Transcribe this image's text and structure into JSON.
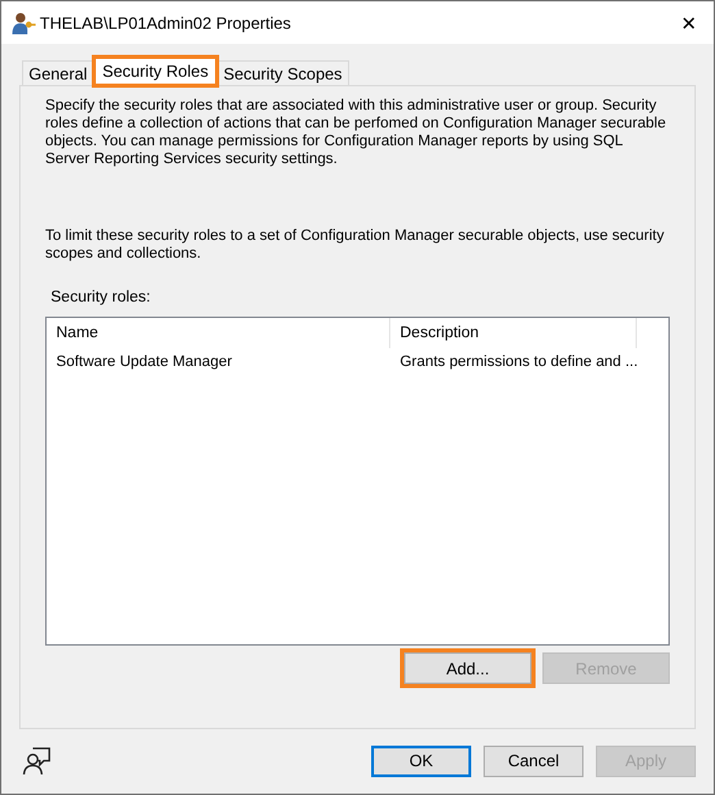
{
  "window": {
    "title": "THELAB\\LP01Admin02 Properties",
    "close": "✕"
  },
  "tabs": [
    {
      "label": "General",
      "selected": false,
      "highlighted": false
    },
    {
      "label": "Security Roles",
      "selected": true,
      "highlighted": true
    },
    {
      "label": "Security Scopes",
      "selected": false,
      "highlighted": false
    }
  ],
  "intro": "Specify the security roles that are associated with this administrative user or group. Security roles define a collection of actions that can be perfomed on Configuration Manager securable objects. You can manage permissions for Configuration Manager reports by using SQL Server Reporting Services security settings.",
  "limit_note": "To limit these security roles to a set of Configuration Manager securable objects, use security scopes and collections.",
  "roles_label": "Security roles:",
  "table": {
    "columns": [
      "Name",
      "Description"
    ],
    "rows": [
      [
        "Software Update Manager",
        "Grants permissions to define and ..."
      ]
    ]
  },
  "list_buttons": [
    {
      "label": "Add...",
      "disabled": false,
      "highlighted": true
    },
    {
      "label": "Remove",
      "disabled": true,
      "highlighted": false
    }
  ],
  "dialog_buttons": [
    {
      "label": "OK",
      "disabled": false,
      "default": true
    },
    {
      "label": "Cancel",
      "disabled": false,
      "default": false
    },
    {
      "label": "Apply",
      "disabled": true,
      "default": false
    }
  ]
}
